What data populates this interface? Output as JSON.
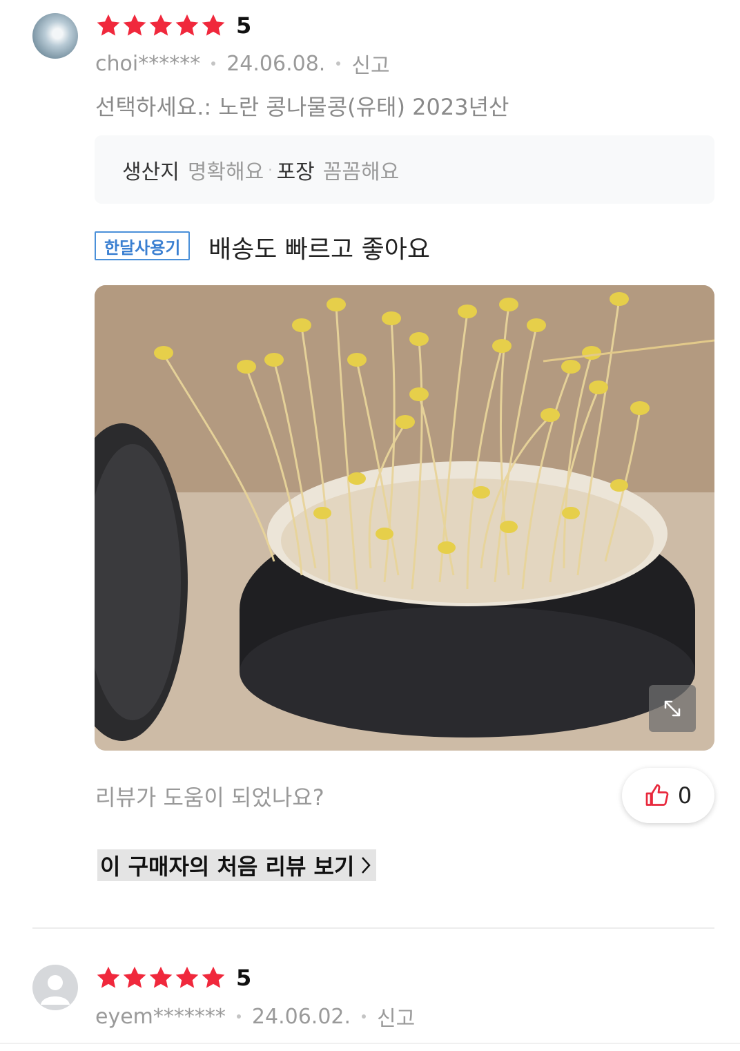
{
  "reviews": [
    {
      "rating": "5",
      "user": "choi******",
      "date": "24.06.08.",
      "report": "신고",
      "option": "선택하세요.: 노란 콩나물콩(유태) 2023년산",
      "tags": [
        {
          "key": "생산지",
          "value": "명확해요"
        },
        {
          "key": "포장",
          "value": "꼼꼼해요"
        }
      ],
      "badge": "한달사용기",
      "headline": "배송도 빠르고 좋아요",
      "photo_icon": "expand-icon",
      "helpful_question": "리뷰가 도움이 되었나요?",
      "like_count": "0",
      "first_review_link": "이 구매자의 처음 리뷰 보기"
    },
    {
      "rating": "5",
      "user": "eyem*******",
      "date": "24.06.02.",
      "report": "신고"
    }
  ],
  "colors": {
    "star": "#f0283c",
    "badge": "#3a7fd1",
    "like_icon": "#e8283c",
    "muted_text": "#9a9a9a"
  }
}
